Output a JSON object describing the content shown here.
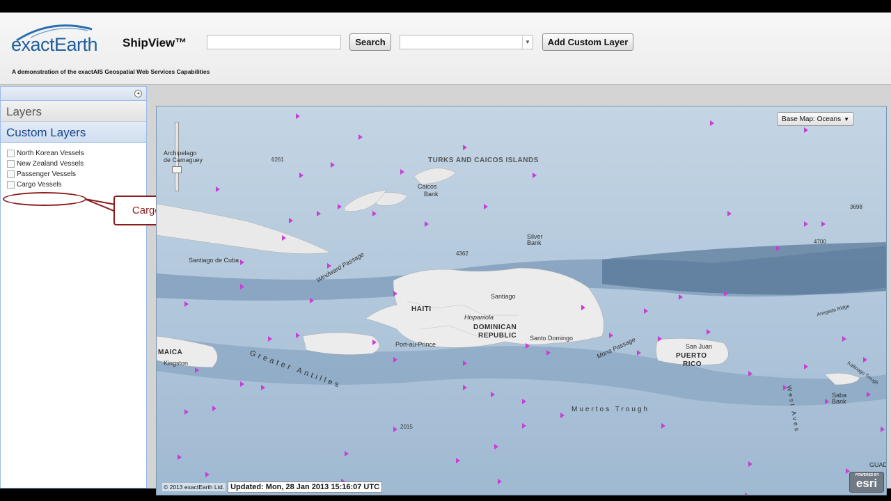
{
  "header": {
    "logo_text": "exactEarth",
    "app_title": "ShipView™",
    "tagline": "A demonstration of the exactAIS Geospatial Web Services Capabilities",
    "search_label": "Search",
    "search_value": "",
    "select_value": "",
    "add_layer_label": "Add Custom Layer"
  },
  "sidebar": {
    "layers_title": "Layers",
    "custom_layers_title": "Custom Layers",
    "items": [
      {
        "label": "North Korean Vessels"
      },
      {
        "label": "New Zealand Vessels"
      },
      {
        "label": "Passenger Vessels"
      },
      {
        "label": "Cargo Vessels"
      }
    ],
    "callout": "Cargo Vessels Filter"
  },
  "map": {
    "basemap_label": "Base Map: Oceans",
    "copyright": "© 2013 exactEarth Ltd.",
    "updated": "Updated: Mon, 28 Jan 2013 15:16:07 UTC",
    "esri_label": "esri",
    "esri_powered": "POWERED BY",
    "labels": {
      "turks": "TURKS AND CAICOS ISLANDS",
      "caicos": "Caicos",
      "caicos2": "Bank",
      "silver": "Silver",
      "silver2": "Bank",
      "santiago_cuba": "Santiago de Cuba",
      "haiti": "HAITI",
      "hispaniola": "Hispaniola",
      "santiago": "Santiago",
      "dominican1": "DOMINICAN",
      "dominican2": "REPUBLIC",
      "santo": "Santo Domingo",
      "port": "Port-au-Prince",
      "jamaica": "MAICA",
      "kingston": "Kingston",
      "san_juan": "San Juan",
      "puerto1": "PUERTO",
      "puerto2": "RICO",
      "windward": "Windward Passage",
      "greater": "Greater Antilles",
      "muertos": "Muertos Trough",
      "mona": "Mona Passage",
      "west_aves": "West Aves",
      "saba1": "Saba",
      "saba2": "Bank",
      "anegada": "Anegada Ridge",
      "kallinago": "Kallinago Trough",
      "archipelago": "Archipelago",
      "camaguey": "de Camaguey",
      "d4362": "4362",
      "d2015": "2015",
      "d6261": "6261",
      "d4700": "4700",
      "d3698": "3698",
      "guad": "GUAD"
    }
  }
}
